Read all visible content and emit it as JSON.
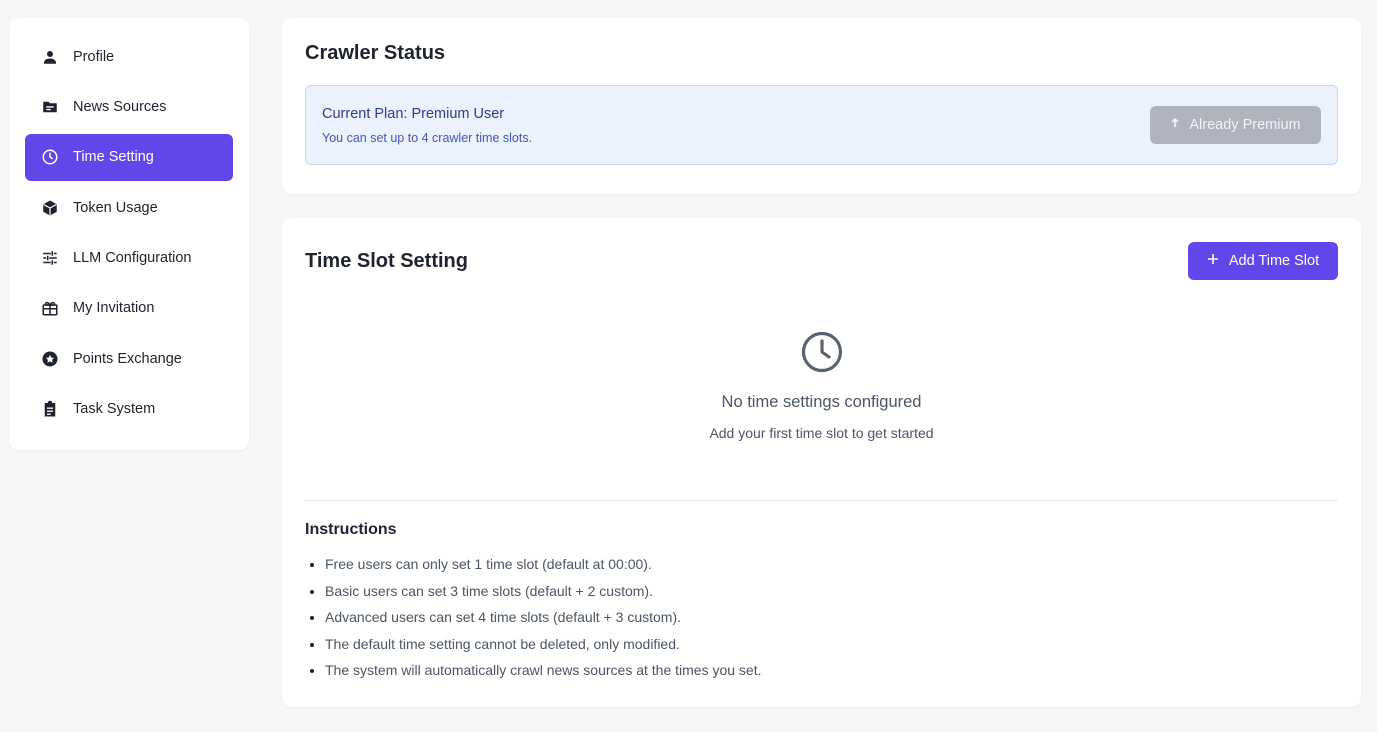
{
  "sidebar": {
    "items": [
      {
        "label": "Profile",
        "icon": "person-icon",
        "active": false
      },
      {
        "label": "News Sources",
        "icon": "folder-icon",
        "active": false
      },
      {
        "label": "Time Setting",
        "icon": "clock-icon",
        "active": true
      },
      {
        "label": "Token Usage",
        "icon": "cube-icon",
        "active": false
      },
      {
        "label": "LLM Configuration",
        "icon": "sliders-icon",
        "active": false
      },
      {
        "label": "My Invitation",
        "icon": "gift-icon",
        "active": false
      },
      {
        "label": "Points Exchange",
        "icon": "star-badge-icon",
        "active": false
      },
      {
        "label": "Task System",
        "icon": "clipboard-icon",
        "active": false
      }
    ]
  },
  "status": {
    "title": "Crawler Status",
    "plan_title": "Current Plan: Premium User",
    "plan_sub": "You can set up to 4 crawler time slots.",
    "premium_button": "Already Premium"
  },
  "slots": {
    "title": "Time Slot Setting",
    "add_button": "Add Time Slot",
    "empty_title": "No time settings configured",
    "empty_sub": "Add your first time slot to get started"
  },
  "instructions": {
    "title": "Instructions",
    "items": [
      "Free users can only set 1 time slot (default at 00:00).",
      "Basic users can set 3 time slots (default + 2 custom).",
      "Advanced users can set 4 time slots (default + 3 custom).",
      "The default time setting cannot be deleted, only modified.",
      "The system will automatically crawl news sources at the times you set."
    ]
  },
  "colors": {
    "accent": "#6246ea",
    "background": "#f5f6f8",
    "plan_box_bg": "#ebf2fd",
    "disabled_button": "#aeb3bd"
  }
}
